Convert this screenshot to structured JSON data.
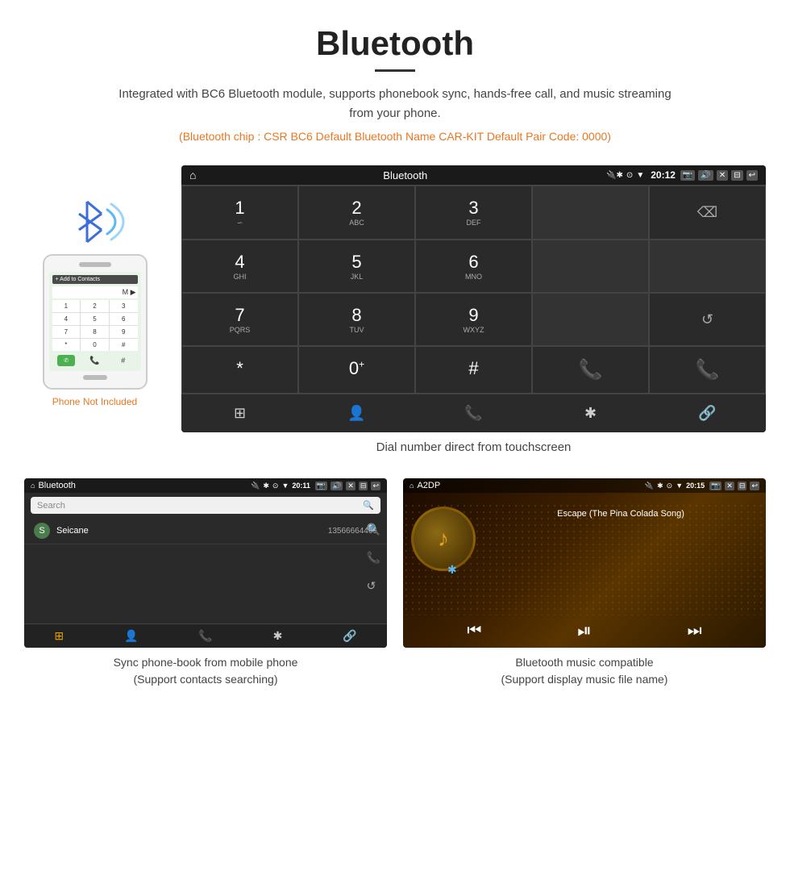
{
  "header": {
    "title": "Bluetooth",
    "description": "Integrated with BC6 Bluetooth module, supports phonebook sync, hands-free call, and music streaming from your phone.",
    "specs": "(Bluetooth chip : CSR BC6    Default Bluetooth Name CAR-KIT    Default Pair Code: 0000)"
  },
  "dial_screen": {
    "status_bar": {
      "title": "Bluetooth",
      "time": "20:12"
    },
    "keypad": [
      {
        "num": "1",
        "letters": "∞"
      },
      {
        "num": "2",
        "letters": "ABC"
      },
      {
        "num": "3",
        "letters": "DEF"
      },
      {
        "num": "",
        "letters": ""
      },
      {
        "num": "⌫",
        "letters": ""
      },
      {
        "num": "4",
        "letters": "GHI"
      },
      {
        "num": "5",
        "letters": "JKL"
      },
      {
        "num": "6",
        "letters": "MNO"
      },
      {
        "num": "",
        "letters": ""
      },
      {
        "num": "",
        "letters": ""
      },
      {
        "num": "7",
        "letters": "PQRS"
      },
      {
        "num": "8",
        "letters": "TUV"
      },
      {
        "num": "9",
        "letters": "WXYZ"
      },
      {
        "num": "",
        "letters": ""
      },
      {
        "num": "↺",
        "letters": ""
      },
      {
        "num": "*",
        "letters": ""
      },
      {
        "num": "0",
        "letters": "+"
      },
      {
        "num": "#",
        "letters": ""
      },
      {
        "num": "📞",
        "letters": "green"
      },
      {
        "num": "📞",
        "letters": "red"
      }
    ],
    "bottom_icons": [
      "⊞",
      "👤",
      "📞",
      "✱",
      "🔗"
    ]
  },
  "dial_caption": "Dial number direct from touchscreen",
  "phonebook_screen": {
    "status_bar": {
      "title": "Bluetooth",
      "time": "20:11"
    },
    "search_placeholder": "Search",
    "contacts": [
      {
        "letter": "S",
        "name": "Seicane",
        "number": "13566664466"
      }
    ],
    "bottom_icons": [
      "⊞",
      "👤",
      "📞",
      "✱",
      "🔗"
    ]
  },
  "phonebook_caption": "Sync phone-book from mobile phone\n(Support contacts searching)",
  "music_screen": {
    "status_bar": {
      "title": "A2DP",
      "time": "20:15"
    },
    "song_title": "Escape (The Pina Colada Song)",
    "controls": [
      "⏮",
      "⏯",
      "⏭"
    ]
  },
  "music_caption": "Bluetooth music compatible\n(Support display music file name)",
  "phone_section": {
    "not_included": "Phone Not Included"
  }
}
